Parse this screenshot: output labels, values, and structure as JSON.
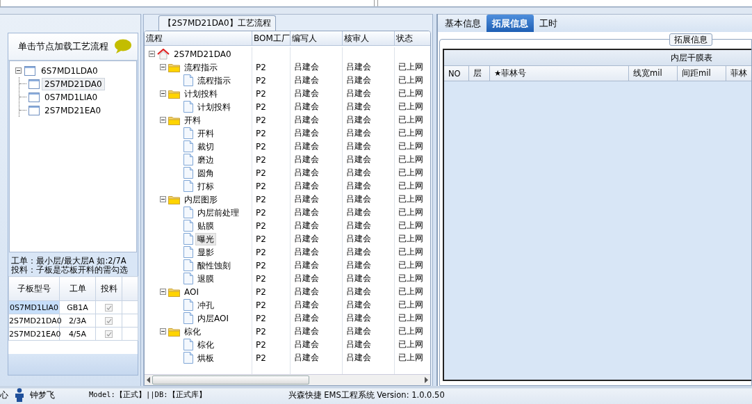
{
  "left_panel": {
    "title": "单击节点加载工艺流程",
    "tree": [
      {
        "label": "6S7MD1LDA0",
        "expanded": true,
        "selected": false,
        "children": [
          {
            "label": "2S7MD21DA0",
            "selected": true
          },
          {
            "label": "0S7MD1LIA0",
            "selected": false
          },
          {
            "label": "2S7MD21EA0",
            "selected": false
          }
        ]
      }
    ],
    "notes": [
      "工单：最小层/最大层A 如:2/7A",
      "投料：子板是芯板开料的需勾选"
    ],
    "grid": {
      "columns": [
        "子板型号",
        "工单",
        "投料"
      ],
      "rows": [
        {
          "model": "0S7MD1LIA0",
          "work_order": "GB1A",
          "checked": true,
          "selected": true
        },
        {
          "model": "2S7MD21DA0",
          "work_order": "2/3A",
          "checked": true,
          "selected": false
        },
        {
          "model": "2S7MD21EA0",
          "work_order": "4/5A",
          "checked": true,
          "selected": false
        }
      ]
    }
  },
  "process_panel": {
    "title": "【2S7MD21DA0】工艺流程",
    "columns": [
      "流程",
      "BOM工厂",
      "编写人",
      "核审人",
      "状态"
    ],
    "root": {
      "label": "2S7MD21DA0",
      "kind": "root",
      "expanded": true,
      "selected": false,
      "children": [
        {
          "label": "流程指示",
          "kind": "folder",
          "expanded": true,
          "selected": false,
          "bom": "P2",
          "writer": "吕建会",
          "reviewer": "吕建会",
          "status": "已上网",
          "children": [
            {
              "label": "流程指示",
              "kind": "document",
              "selected": false,
              "bom": "P2",
              "writer": "吕建会",
              "reviewer": "吕建会",
              "status": "已上网"
            }
          ]
        },
        {
          "label": "计划投料",
          "kind": "folder",
          "expanded": true,
          "selected": false,
          "bom": "P2",
          "writer": "吕建会",
          "reviewer": "吕建会",
          "status": "已上网",
          "children": [
            {
              "label": "计划投料",
              "kind": "document",
              "selected": false,
              "bom": "P2",
              "writer": "吕建会",
              "reviewer": "吕建会",
              "status": "已上网"
            }
          ]
        },
        {
          "label": "开料",
          "kind": "folder",
          "expanded": true,
          "selected": false,
          "bom": "P2",
          "writer": "吕建会",
          "reviewer": "吕建会",
          "status": "已上网",
          "children": [
            {
              "label": "开料",
              "kind": "document",
              "selected": false,
              "bom": "P2",
              "writer": "吕建会",
              "reviewer": "吕建会",
              "status": "已上网"
            },
            {
              "label": "裁切",
              "kind": "document",
              "selected": false,
              "bom": "P2",
              "writer": "吕建会",
              "reviewer": "吕建会",
              "status": "已上网"
            },
            {
              "label": "磨边",
              "kind": "document",
              "selected": false,
              "bom": "P2",
              "writer": "吕建会",
              "reviewer": "吕建会",
              "status": "已上网"
            },
            {
              "label": "圆角",
              "kind": "document",
              "selected": false,
              "bom": "P2",
              "writer": "吕建会",
              "reviewer": "吕建会",
              "status": "已上网"
            },
            {
              "label": "打标",
              "kind": "document",
              "selected": false,
              "bom": "P2",
              "writer": "吕建会",
              "reviewer": "吕建会",
              "status": "已上网"
            }
          ]
        },
        {
          "label": "内层图形",
          "kind": "folder",
          "expanded": true,
          "selected": false,
          "bom": "P2",
          "writer": "吕建会",
          "reviewer": "吕建会",
          "status": "已上网",
          "children": [
            {
              "label": "内层前处理",
              "kind": "document",
              "selected": false,
              "bom": "P2",
              "writer": "吕建会",
              "reviewer": "吕建会",
              "status": "已上网"
            },
            {
              "label": "贴膜",
              "kind": "document",
              "selected": false,
              "bom": "P2",
              "writer": "吕建会",
              "reviewer": "吕建会",
              "status": "已上网"
            },
            {
              "label": "曝光",
              "kind": "document",
              "selected": true,
              "bom": "P2",
              "writer": "吕建会",
              "reviewer": "吕建会",
              "status": "已上网"
            },
            {
              "label": "显影",
              "kind": "document",
              "selected": false,
              "bom": "P2",
              "writer": "吕建会",
              "reviewer": "吕建会",
              "status": "已上网"
            },
            {
              "label": "酸性蚀刻",
              "kind": "document",
              "selected": false,
              "bom": "P2",
              "writer": "吕建会",
              "reviewer": "吕建会",
              "status": "已上网"
            },
            {
              "label": "退膜",
              "kind": "document",
              "selected": false,
              "bom": "P2",
              "writer": "吕建会",
              "reviewer": "吕建会",
              "status": "已上网"
            }
          ]
        },
        {
          "label": "AOI",
          "kind": "folder",
          "expanded": true,
          "selected": false,
          "bom": "P2",
          "writer": "吕建会",
          "reviewer": "吕建会",
          "status": "已上网",
          "children": [
            {
              "label": "冲孔",
              "kind": "document",
              "selected": false,
              "bom": "P2",
              "writer": "吕建会",
              "reviewer": "吕建会",
              "status": "已上网"
            },
            {
              "label": "内层AOI",
              "kind": "document",
              "selected": false,
              "bom": "P2",
              "writer": "吕建会",
              "reviewer": "吕建会",
              "status": "已上网"
            }
          ]
        },
        {
          "label": "棕化",
          "kind": "folder",
          "expanded": true,
          "selected": false,
          "bom": "P2",
          "writer": "吕建会",
          "reviewer": "吕建会",
          "status": "已上网",
          "children": [
            {
              "label": "棕化",
              "kind": "document",
              "selected": false,
              "bom": "P2",
              "writer": "吕建会",
              "reviewer": "吕建会",
              "status": "已上网"
            },
            {
              "label": "烘板",
              "kind": "document",
              "selected": false,
              "bom": "P2",
              "writer": "吕建会",
              "reviewer": "吕建会",
              "status": "已上网"
            }
          ]
        }
      ]
    }
  },
  "info_panel": {
    "tabs": [
      {
        "label": "基本信息",
        "selected": false
      },
      {
        "label": "拓展信息",
        "selected": true
      },
      {
        "label": "工时",
        "selected": false
      }
    ],
    "group_title": "拓展信息",
    "table_title": "内层干膜表",
    "columns": [
      "NO",
      "层",
      "★菲林号",
      "线宽mil",
      "间距mil",
      "菲林"
    ]
  },
  "status_bar": {
    "cut_text": "心",
    "user": "钟梦飞",
    "model_db": "Model:【正式】||DB:【正式库】",
    "app_info": "兴森快捷 EMS工程系统 Version: 1.0.0.50"
  }
}
